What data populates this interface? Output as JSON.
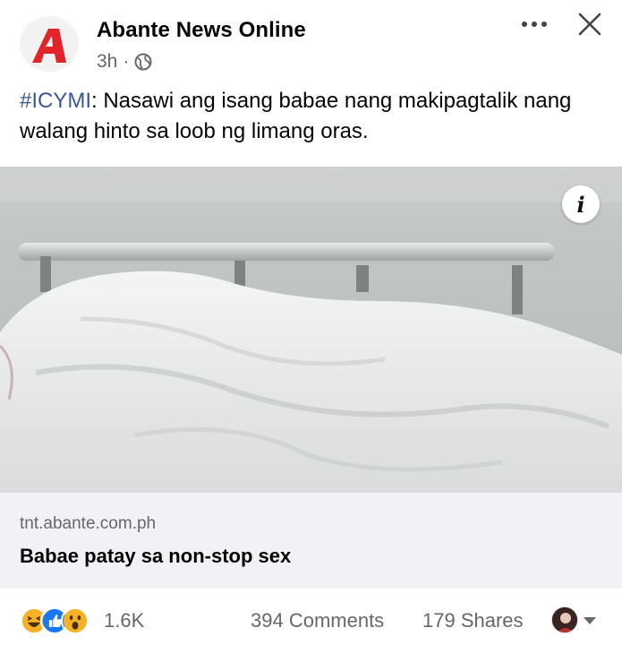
{
  "post": {
    "page_name": "Abante News Online",
    "time": "3h",
    "separator": "·",
    "caption_hashtag": "#ICYMI",
    "caption_text": ": Nasawi ang isang babae nang makipagtalik nang walang hinto sa loob ng limang oras."
  },
  "logo": {
    "letter": "A",
    "color": "#e0242a"
  },
  "link": {
    "domain": "tnt.abante.com.ph",
    "title": "Babae patay sa non-stop sex"
  },
  "footer": {
    "reaction_icons": [
      "haha-icon",
      "like-icon",
      "wow-icon"
    ],
    "reaction_count": "1.6K",
    "comments": "394 Comments",
    "shares": "179 Shares"
  },
  "colors": {
    "hashtag": "#385898",
    "muted": "#65676b",
    "link_bg": "#f0f2f5"
  }
}
